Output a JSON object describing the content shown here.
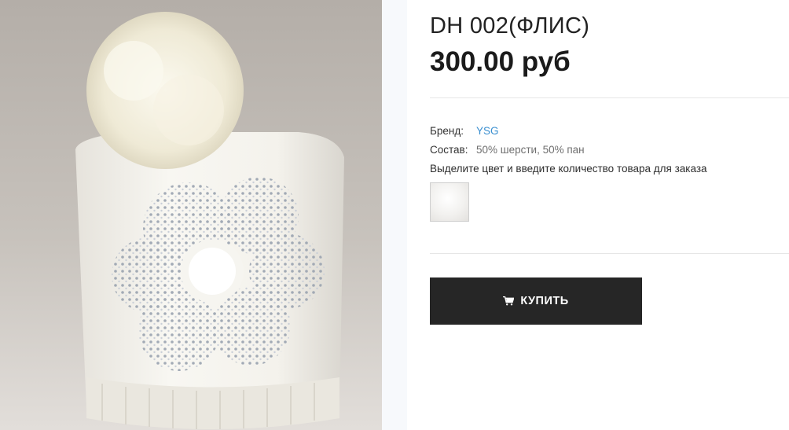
{
  "product": {
    "image_alt": "winter hat with rhinestone flower and fur pompom",
    "title": "DH 002(ФЛИС)",
    "price": "300.00 руб"
  },
  "attributes": {
    "brand_label": "Бренд:",
    "brand_value": "YSG",
    "composition_label": "Состав:",
    "composition_value": "50% шерсти, 50% пан"
  },
  "order_hint": "Выделите цвет и введите количество товара для заказа",
  "swatches": [
    {
      "color": "#f4f3f1",
      "name": "white"
    }
  ],
  "buy_button": {
    "label": "КУПИТЬ",
    "icon": "cart-icon"
  },
  "colors": {
    "button_bg": "#262626",
    "link": "#3a8fd0"
  }
}
